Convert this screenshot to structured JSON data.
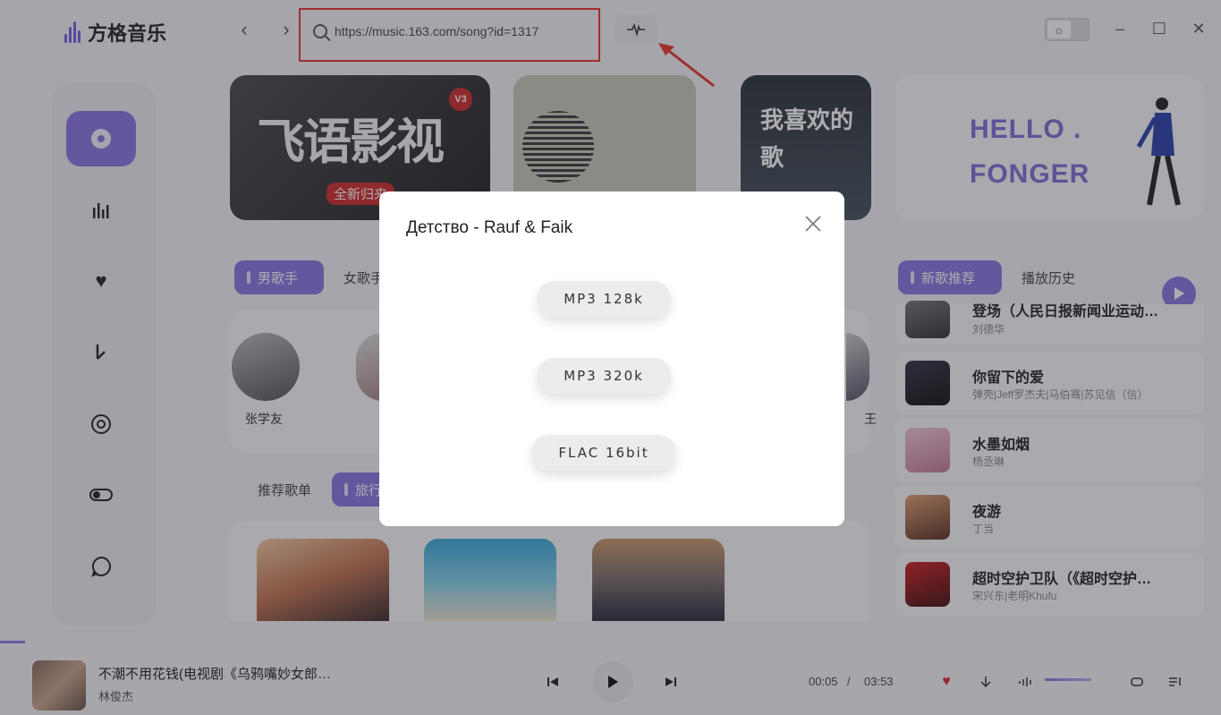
{
  "app": {
    "name": "方格音乐"
  },
  "colors": {
    "accent": "#8b74e0",
    "highlight_box": "#e8352e",
    "heart": "#d9263a"
  },
  "search": {
    "value": "https://music.163.com/song?id=1317"
  },
  "banners": [
    {
      "text": "飞语影视",
      "badge": "V3",
      "sub": "全新归来"
    },
    {
      "text": ""
    },
    {
      "text": "我喜欢的歌"
    },
    {
      "text_line1": "HELLO .",
      "text_line2": "FONGER"
    }
  ],
  "sidebar": {
    "items": [
      "disc-icon",
      "bars-icon",
      "heart-icon",
      "download-icon",
      "record-icon",
      "toggle-icon",
      "chat-icon"
    ]
  },
  "singer_tabs": [
    "男歌手",
    "女歌手"
  ],
  "singers": [
    "张学友",
    "王"
  ],
  "playlist_tabs": [
    "推荐歌单",
    "旅行"
  ],
  "right_tabs": [
    "新歌推荐",
    "播放历史"
  ],
  "songs": [
    {
      "title": "登场（人民日报新闻业运动…",
      "artist": "刘德华"
    },
    {
      "title": "你留下的爱",
      "artist": "弹壳|Jeff罗杰夫|马伯骞|苏见信（信）"
    },
    {
      "title": "水墨如烟",
      "artist": "杨丞琳"
    },
    {
      "title": "夜游",
      "artist": "丁当"
    },
    {
      "title": "超时空护卫队（《超时空护…",
      "artist": "宋兴东|老明Khufu"
    }
  ],
  "modal": {
    "title": "Детство - Rauf & Faik",
    "options": [
      "MP3 128k",
      "MP3 320k",
      "FLAC 16bit"
    ]
  },
  "player": {
    "title": "不潮不用花钱(电视剧《乌鸦嘴妙女郎…",
    "artist": "林俊杰",
    "current_time": "00:05",
    "separator": "/",
    "duration": "03:53",
    "progress": 0.02
  }
}
